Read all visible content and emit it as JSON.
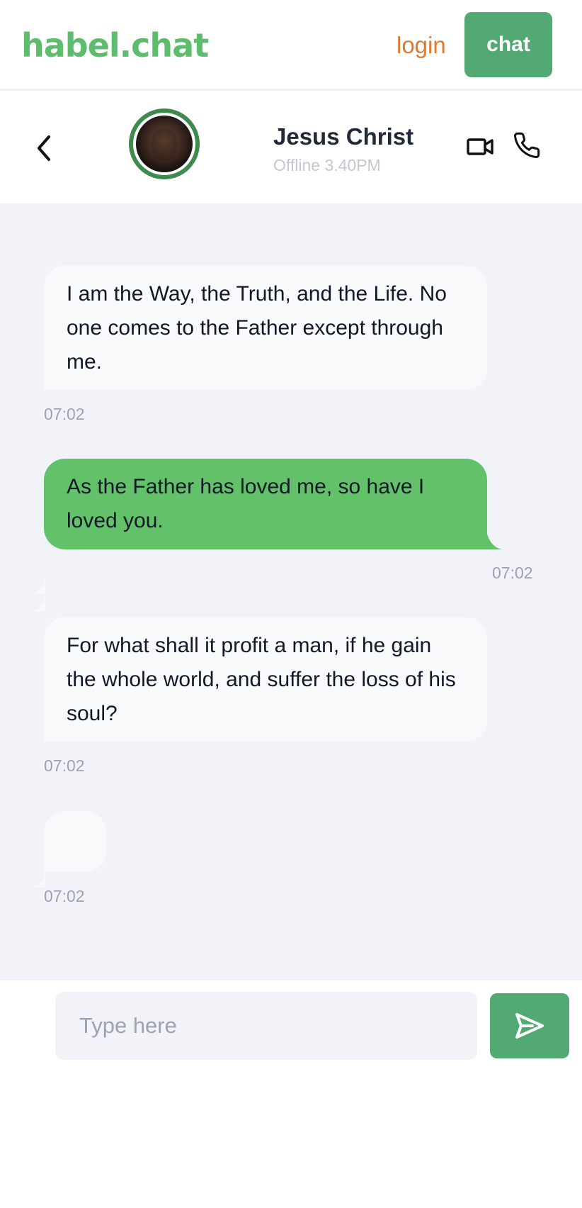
{
  "nav": {
    "brand": "habel.chat",
    "login_label": "login",
    "chat_label": "chat"
  },
  "contact": {
    "name": "Jesus Christ",
    "status": "Offline 3.40PM",
    "avatar_icon": "avatar-photo"
  },
  "header_icons": {
    "back": "chevron-left-icon",
    "video": "video-camera-icon",
    "phone": "phone-icon"
  },
  "messages": [
    {
      "direction": "incoming",
      "text": "I am the Way, the Truth, and the Life. No one comes to the Father except through me.",
      "time": "07:02"
    },
    {
      "direction": "outgoing",
      "text": "As the Father has loved me, so have I loved you.",
      "time": "07:02"
    },
    {
      "direction": "incoming",
      "text": "For what shall it profit a man, if he gain the whole world, and suffer the loss of his soul?",
      "time": "07:02"
    },
    {
      "direction": "incoming",
      "text": "",
      "time": "07:02"
    }
  ],
  "composer": {
    "placeholder": "Type here",
    "send_icon": "send-icon"
  },
  "colors": {
    "brand_green": "#5ebd6d",
    "button_green": "#52a974",
    "outgoing_bubble": "#63c269",
    "login_orange": "#e07b2e",
    "chat_background": "#f1f3f9"
  }
}
